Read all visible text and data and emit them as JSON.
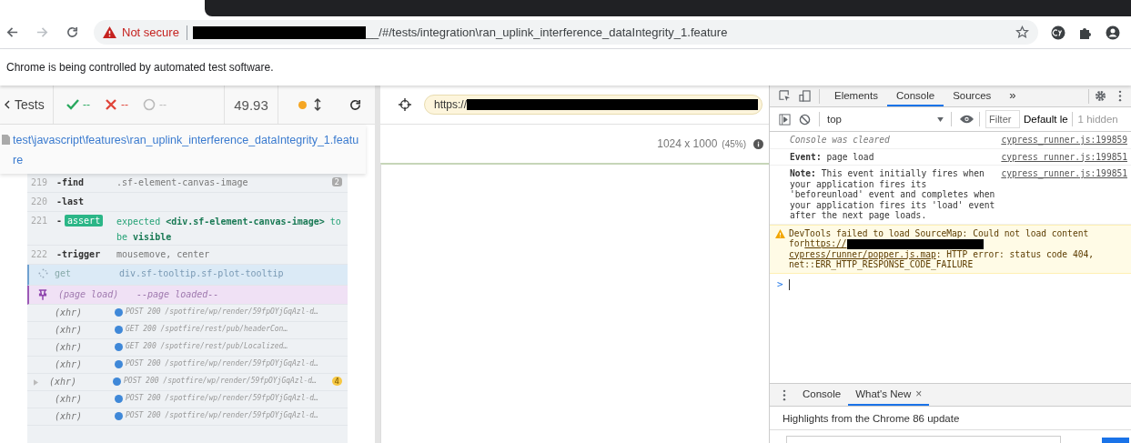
{
  "browser": {
    "security": "Not secure",
    "url": "__/#/tests/integration\\ran_uplink_interference_dataIntegrity_1.feature",
    "infobar": "Chrome is being controlled by automated test software."
  },
  "reporter": {
    "back": "Tests",
    "stats": [
      {
        "kind": "passed",
        "value": "--"
      },
      {
        "kind": "failed",
        "value": "--"
      },
      {
        "kind": "pending",
        "value": "--"
      }
    ],
    "duration": "49.93",
    "spec": "test\\javascript\\features\\ran_uplink_interference_dataIntegrity_1.feature",
    "commands": [
      {
        "kind": "command",
        "number": "219",
        "name": "-find",
        "message": ".sf-element-canvas-image",
        "count": "2"
      },
      {
        "kind": "command",
        "number": "220",
        "name": "-last"
      },
      {
        "kind": "assert",
        "number": "221",
        "marker": "-",
        "name": "assert",
        "message": "expected **<div.sf-element-canvas-image>** to be **visible**"
      },
      {
        "kind": "command",
        "number": "222",
        "name": "-trigger",
        "message": "mousemove, center"
      },
      {
        "kind": "pending",
        "name": "get",
        "message": "div.sf-tooltip.sf-plot-tooltip"
      },
      {
        "kind": "event",
        "name": "(page load)",
        "message": "--page loaded--"
      },
      {
        "kind": "xhr",
        "name": "(xhr)",
        "message": "POST 200 /spotfire/wp/render/59fpOYjGqAzl-d…"
      },
      {
        "kind": "xhr",
        "name": "(xhr)",
        "message": "GET 200 /spotfire/rest/pub/headerCon…"
      },
      {
        "kind": "xhr",
        "name": "(xhr)",
        "message": "GET 200 /spotfire/rest/pub/Localized…"
      },
      {
        "kind": "xhr",
        "name": "(xhr)",
        "message": "POST 200 /spotfire/wp/render/59fpOYjGqAzl-d…"
      },
      {
        "kind": "xhr-group",
        "name": "(xhr)",
        "message": "POST 200 /spotfire/wp/render/59fpOYjGqAzl-d…",
        "count": "4"
      },
      {
        "kind": "xhr",
        "name": "(xhr)",
        "message": "POST 200 /spotfire/wp/render/59fpOYjGqAzl-d…"
      },
      {
        "kind": "xhr",
        "name": "(xhr)",
        "message": "POST 200 /spotfire/wp/render/59fpOYjGqAzl-d…"
      }
    ]
  },
  "aut": {
    "url": "https://",
    "viewport": "1024 x 1000",
    "scale": "(45%)"
  },
  "devtools": {
    "tabs": [
      {
        "label": "Elements",
        "selected": false
      },
      {
        "label": "Console",
        "selected": true
      },
      {
        "label": "Sources",
        "selected": false
      }
    ],
    "more": "»",
    "context": "top",
    "filter": {
      "placeholder": "Filter"
    },
    "levels": "Default le",
    "hidden": "1 hidden",
    "messages": [
      {
        "kind": "cleared",
        "text": "Console was cleared",
        "source": "cypress_runner.js:199859"
      },
      {
        "kind": "log",
        "text": "**Event:**  page load",
        "source": "cypress_runner.js:199851"
      },
      {
        "kind": "log",
        "text": "**Note:**   This event initially fires when your application fires its 'beforeunload' event and completes when your application fires its 'load' event after the next page loads.",
        "source": "cypress_runner.js:199851"
      }
    ],
    "warning": {
      "text": "DevTools failed to load SourceMap: Could not load content for",
      "link_start": "https://",
      "link_end": "cypress/runner/popper.js.map",
      "rest": ": HTTP error: status code 404, net::ERR_HTTP_RESPONSE_CODE_FAILURE"
    },
    "prompt": ">",
    "drawer": {
      "tabs": [
        {
          "label": "Console",
          "selected": false,
          "closable": false
        },
        {
          "label": "What's New",
          "selected": true,
          "closable": true
        }
      ],
      "close": "×",
      "headline": "Highlights from the Chrome 86 update"
    }
  }
}
